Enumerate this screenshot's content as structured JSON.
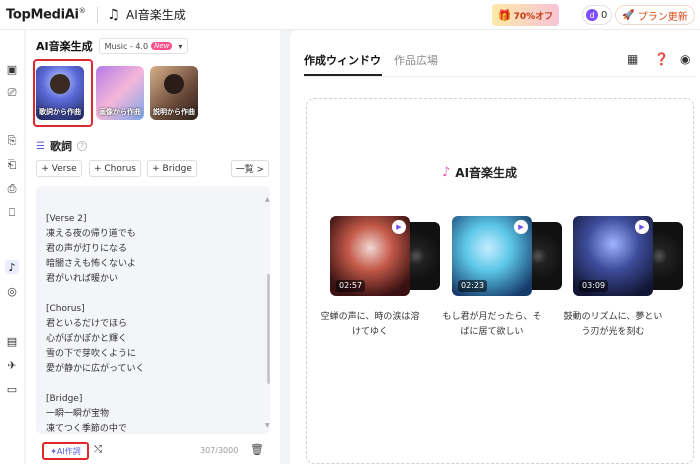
{
  "topbar": {
    "brand": "TopMediAi",
    "brand_mark": "®",
    "app_title": "AI音楽生成",
    "promo_text": "70%オフ",
    "credits": "0",
    "upgrade_label": "プラン更新"
  },
  "left": {
    "title": "AI音楽生成",
    "model": "Music - 4.0",
    "model_badge": "New",
    "cards": [
      {
        "label": "歌詞から作曲"
      },
      {
        "label": "画像から作曲"
      },
      {
        "label": "説明から作曲"
      }
    ],
    "lyrics_title": "歌詞",
    "tags": [
      "+ Verse",
      "+ Chorus",
      "+ Bridge",
      "一覧 >"
    ],
    "lyrics_lines": [
      "[Verse 2]",
      "凍える夜の帰り道でも",
      "君の声が灯りになる",
      "暗闇さえも怖くないよ",
      "君がいれば暖かい",
      "",
      "[Chorus]",
      "君といるだけでほら",
      "心がぽかぽかと輝く",
      "雪の下で芽吹くように",
      "愛が静かに広がっていく",
      "",
      "[Bridge]",
      "一瞬一瞬が宝物",
      "凍てつく季節の中で"
    ],
    "ai_button": "AI作詞",
    "count": "307/3000"
  },
  "right": {
    "tabs": [
      "作成ウィンドウ",
      "作品広場"
    ],
    "gen_title": "AI音楽生成",
    "songs": [
      {
        "duration": "02:57",
        "desc": "空蝉の声に、時の涙は溶けてゆく"
      },
      {
        "duration": "02:23",
        "desc": "もし君が月だったら、そばに居て欲しい"
      },
      {
        "duration": "03:09",
        "desc": "鼓動のリズムに、夢という刃が光を刻む"
      }
    ]
  }
}
